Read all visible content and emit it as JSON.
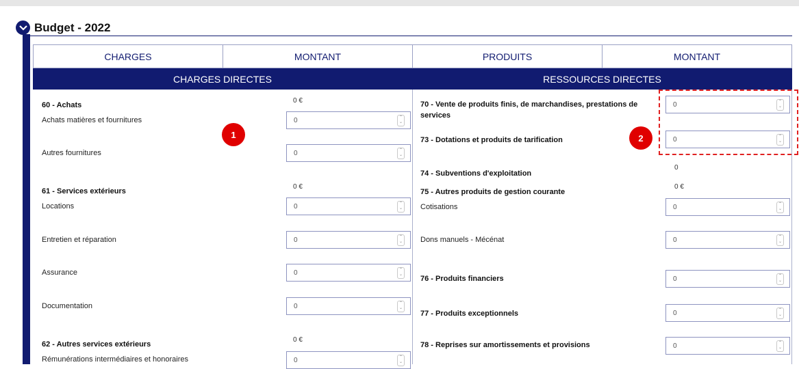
{
  "section": {
    "title": "Budget - 2022"
  },
  "table": {
    "headers": [
      "CHARGES",
      "MONTANT",
      "PRODUITS",
      "MONTANT"
    ],
    "left_band": "CHARGES DIRECTES",
    "right_band": "RESSOURCES DIRECTES"
  },
  "charges": {
    "g60": {
      "label": "60 - Achats",
      "total": "0 €"
    },
    "achats_matieres": {
      "label": "Achats matières et fournitures",
      "value": "0"
    },
    "autres_fournitures": {
      "label": "Autres fournitures",
      "value": "0"
    },
    "g61": {
      "label": "61 - Services extérieurs",
      "total": "0 €"
    },
    "locations": {
      "label": "Locations",
      "value": "0"
    },
    "entretien": {
      "label": "Entretien et réparation",
      "value": "0"
    },
    "assurance": {
      "label": "Assurance",
      "value": "0"
    },
    "documentation": {
      "label": "Documentation",
      "value": "0"
    },
    "g62": {
      "label": "62 - Autres services extérieurs",
      "total": "0 €"
    },
    "remunerations": {
      "label": "Rémunérations intermédiaires et honoraires",
      "value": "0"
    }
  },
  "produits": {
    "p70": {
      "label_line1": "70 - Vente de produits finis, de marchandises, prestations de",
      "label_line2": "services",
      "value": "0"
    },
    "p73": {
      "label": "73 - Dotations et produits de tarification",
      "value": "0"
    },
    "p74": {
      "label": "74 - Subventions d'exploitation",
      "total": "0"
    },
    "p75": {
      "label": "75 - Autres produits de gestion courante",
      "total": "0 €"
    },
    "cotisations": {
      "label": "Cotisations",
      "value": "0"
    },
    "dons": {
      "label": "Dons manuels - Mécénat",
      "value": "0"
    },
    "p76": {
      "label": "76 - Produits financiers",
      "value": "0"
    },
    "p77": {
      "label": "77 - Produits exceptionnels",
      "value": "0"
    },
    "p78": {
      "label": "78 - Reprises sur amortissements et provisions",
      "value": "0"
    }
  },
  "callouts": [
    "1",
    "2"
  ],
  "icons": {
    "toggle": "chevron-down-icon",
    "spinner": "spinner-arrows-icon"
  },
  "colors": {
    "navy": "#111b70",
    "callout_red": "#e00000"
  }
}
